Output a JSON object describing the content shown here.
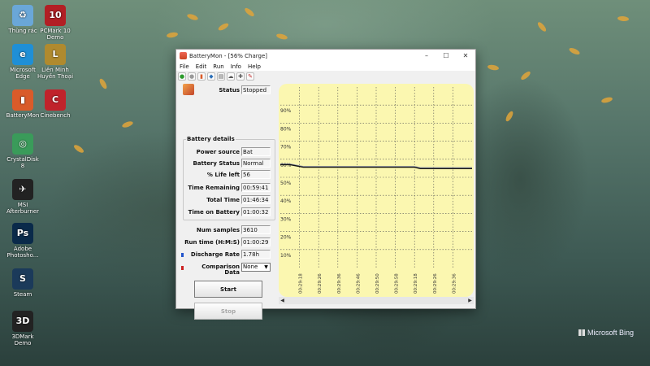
{
  "desktop": {
    "icons": [
      {
        "label": "Thùng rác",
        "glyph": "♻",
        "icon": "recycle-bin-icon",
        "color": "#6aa7d8"
      },
      {
        "label": "PCMark 10\nDemo",
        "glyph": "10",
        "icon": "pcmark-icon",
        "color": "#b21f24"
      },
      {
        "label": "Microsoft\nEdge",
        "glyph": "e",
        "icon": "edge-icon",
        "color": "#1f8fd6"
      },
      {
        "label": "Liên Minh\nHuyền Thoại",
        "glyph": "L",
        "icon": "lol-icon",
        "color": "#b08a2e"
      },
      {
        "label": "BatteryMon",
        "glyph": "▮",
        "icon": "batterymon-icon",
        "color": "#d95b2a"
      },
      {
        "label": "Cinebench",
        "glyph": "C",
        "icon": "cinebench-icon",
        "color": "#c0232b"
      },
      {
        "label": "CrystalDisk\n8",
        "glyph": "◎",
        "icon": "crystaldisk-icon",
        "color": "#3a9b5a"
      },
      {
        "label": "MSI\nAfterburner",
        "glyph": "✈",
        "icon": "afterburner-icon",
        "color": "#222"
      },
      {
        "label": "Adobe\nPhotosho...",
        "glyph": "Ps",
        "icon": "photoshop-icon",
        "color": "#0a2a4a"
      },
      {
        "label": "Steam",
        "glyph": "S",
        "icon": "steam-icon",
        "color": "#1b3a5a"
      },
      {
        "label": "3DMark\nDemo",
        "glyph": "3D",
        "icon": "3dmark-icon",
        "color": "#222"
      }
    ],
    "bing": "Microsoft Bing"
  },
  "window": {
    "title": "BatteryMon - [56% Charge]",
    "menu": [
      "File",
      "Edit",
      "Run",
      "Info",
      "Help"
    ],
    "controls": {
      "minimize": "–",
      "maximize": "☐",
      "close": "✕"
    },
    "toolbar": [
      {
        "glyph": "●",
        "icon": "start-icon",
        "color": "#2a9a2a"
      },
      {
        "glyph": "●",
        "icon": "stop-icon",
        "color": "#999"
      },
      {
        "glyph": "▮",
        "icon": "battery-icon",
        "color": "#d95b2a"
      },
      {
        "glyph": "◆",
        "icon": "info-icon",
        "color": "#2b6fb8"
      },
      {
        "glyph": "▤",
        "icon": "log-icon",
        "color": "#555"
      },
      {
        "glyph": "☁",
        "icon": "cloud-icon",
        "color": "#555"
      },
      {
        "glyph": "✚",
        "icon": "config-icon",
        "color": "#555"
      },
      {
        "glyph": "✎",
        "icon": "edit-icon",
        "color": "#c03030"
      }
    ]
  },
  "status": {
    "label": "Status",
    "value": "Stopped"
  },
  "battery_details": {
    "title": "Battery details",
    "rows": [
      {
        "label": "Power source",
        "value": "Bat"
      },
      {
        "label": "Battery Status",
        "value": "Normal"
      },
      {
        "label": "% Life left",
        "value": "56"
      },
      {
        "label": "Time Remaining",
        "value": "00:59:41"
      },
      {
        "label": "Total Time",
        "value": "01:46:34"
      },
      {
        "label": "Time on Battery",
        "value": "01:00:32"
      }
    ]
  },
  "stats": {
    "num_samples": {
      "label": "Num samples",
      "value": "3610"
    },
    "run_time": {
      "label": "Run time (H:M:S)",
      "value": "01:00:29"
    },
    "discharge": {
      "label": "Discharge Rate",
      "value": "1.78h",
      "color": "#2255cc"
    },
    "comparison": {
      "label": "Comparison\nData",
      "value": "None",
      "color": "#cc2222"
    }
  },
  "buttons": {
    "start": "Start",
    "stop": "Stop"
  },
  "chart_data": {
    "type": "line",
    "background": "#fbf7b0",
    "y_tick_labels": [
      "90%",
      "80%",
      "70%",
      "60%",
      "50%",
      "40%",
      "30%",
      "20%",
      "10%"
    ],
    "y_ticks": [
      90,
      80,
      70,
      60,
      50,
      40,
      30,
      20,
      10
    ],
    "ylim": [
      0,
      100
    ],
    "x_tick_labels": [
      "00:29:18",
      "00:29:26",
      "00:29:36",
      "00:29:46",
      "00:29:50",
      "00:29:58",
      "00:29:18",
      "00:29:26",
      "00:29:36"
    ],
    "series": [
      {
        "color": "#111111",
        "x": [
          0,
          0.5,
          1.2,
          7.0,
          7.3,
          10.0
        ],
        "y": [
          57,
          57,
          55.6,
          55.6,
          54.8,
          54.8
        ]
      },
      {
        "color": "#9aa0b0",
        "x": [
          0,
          0.5,
          1.2,
          7.0,
          7.3,
          10.0
        ],
        "y": [
          57.4,
          57.4,
          56.0,
          56.0,
          55.4,
          55.4
        ]
      }
    ],
    "xlim": [
      0,
      10
    ]
  }
}
